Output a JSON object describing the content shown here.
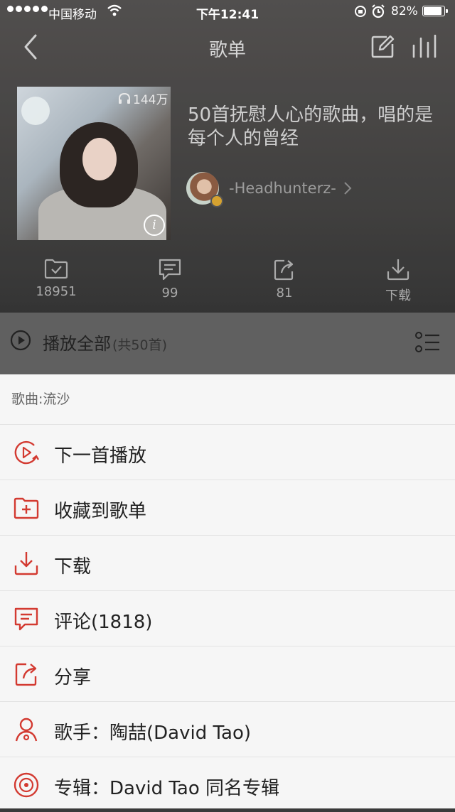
{
  "status": {
    "carrier": "中国移动",
    "time": "下午12:41",
    "battery": "82%",
    "battery_level": 0.82
  },
  "nav": {
    "title": "歌单"
  },
  "playlist": {
    "play_count": "144万",
    "title": "50首抚慰人心的歌曲，唱的是每个人的曾经",
    "creator": "-Headhunterz-"
  },
  "actions": {
    "collect": "18951",
    "comment": "99",
    "share": "81",
    "download": "下载"
  },
  "play_all": {
    "label": "播放全部",
    "count": "(共50首)"
  },
  "sheet": {
    "header": "歌曲:流沙",
    "items": [
      {
        "label": "下一首播放",
        "icon": "play-next-icon"
      },
      {
        "label": "收藏到歌单",
        "icon": "add-to-playlist-icon"
      },
      {
        "label": "下载",
        "icon": "download-icon"
      },
      {
        "label": "评论(1818)",
        "icon": "comment-icon"
      },
      {
        "label": "分享",
        "icon": "share-icon"
      },
      {
        "label": "歌手：陶喆(David Tao)",
        "icon": "artist-icon"
      },
      {
        "label": "专辑：David Tao 同名专辑",
        "icon": "album-icon"
      }
    ]
  },
  "colors": {
    "accent": "#d33a31",
    "sheet_bg": "#f6f6f6"
  }
}
